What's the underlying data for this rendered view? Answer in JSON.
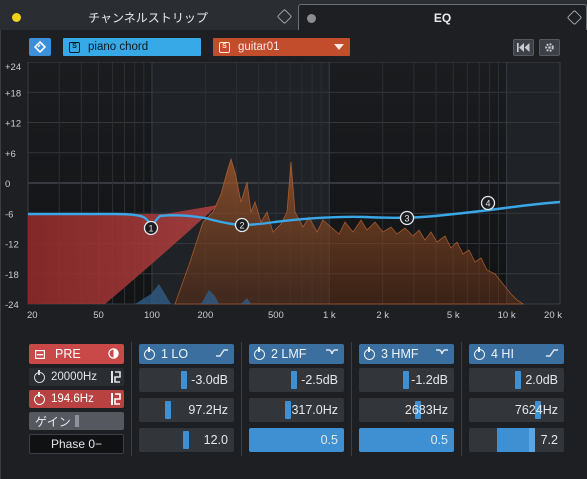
{
  "tabs": [
    {
      "label": "チャンネルストリップ",
      "active": false
    },
    {
      "label": "EQ",
      "active": true
    }
  ],
  "toolbar": {
    "preset_name": "piano chord",
    "track_name": "guitar01",
    "preset_icon": "S",
    "track_icon": "S"
  },
  "graph": {
    "y_labels": [
      "+24",
      "+18",
      "+12",
      "+6",
      "0",
      "-6",
      "-12",
      "-18",
      "-24"
    ],
    "x_labels": [
      "20",
      "50",
      "100",
      "200",
      "500",
      "1 k",
      "2 k",
      "5 k",
      "10 k",
      "20 k"
    ],
    "band_nodes": [
      "1",
      "2",
      "3",
      "4"
    ]
  },
  "pre": {
    "title": "PRE",
    "hicut": "20000Hz",
    "locut": "194.6Hz",
    "gain_label": "ゲイン",
    "phase_label": "Phase 0−"
  },
  "bands": [
    {
      "title": "1 LO",
      "shape_icon": "low-shelf-icon",
      "gain": "-3.0dB",
      "freq": "97.2Hz",
      "q": "12.0"
    },
    {
      "title": "2 LMF",
      "shape_icon": "peak-icon",
      "gain": "-2.5dB",
      "freq": "317.0Hz",
      "q": "0.5"
    },
    {
      "title": "3 HMF",
      "shape_icon": "peak-icon",
      "gain": "-1.2dB",
      "freq": "2683Hz",
      "q": "0.5"
    },
    {
      "title": "4 HI",
      "shape_icon": "high-shelf-icon",
      "gain": "2.0dB",
      "freq": "7624Hz",
      "q": "7.2"
    }
  ],
  "colors": {
    "accent_blue": "#3c8fd9",
    "preset_blue": "#36a9e6",
    "track_orange": "#c24d2c",
    "pre_red": "#c94848",
    "curve": "#3aa8e8"
  }
}
